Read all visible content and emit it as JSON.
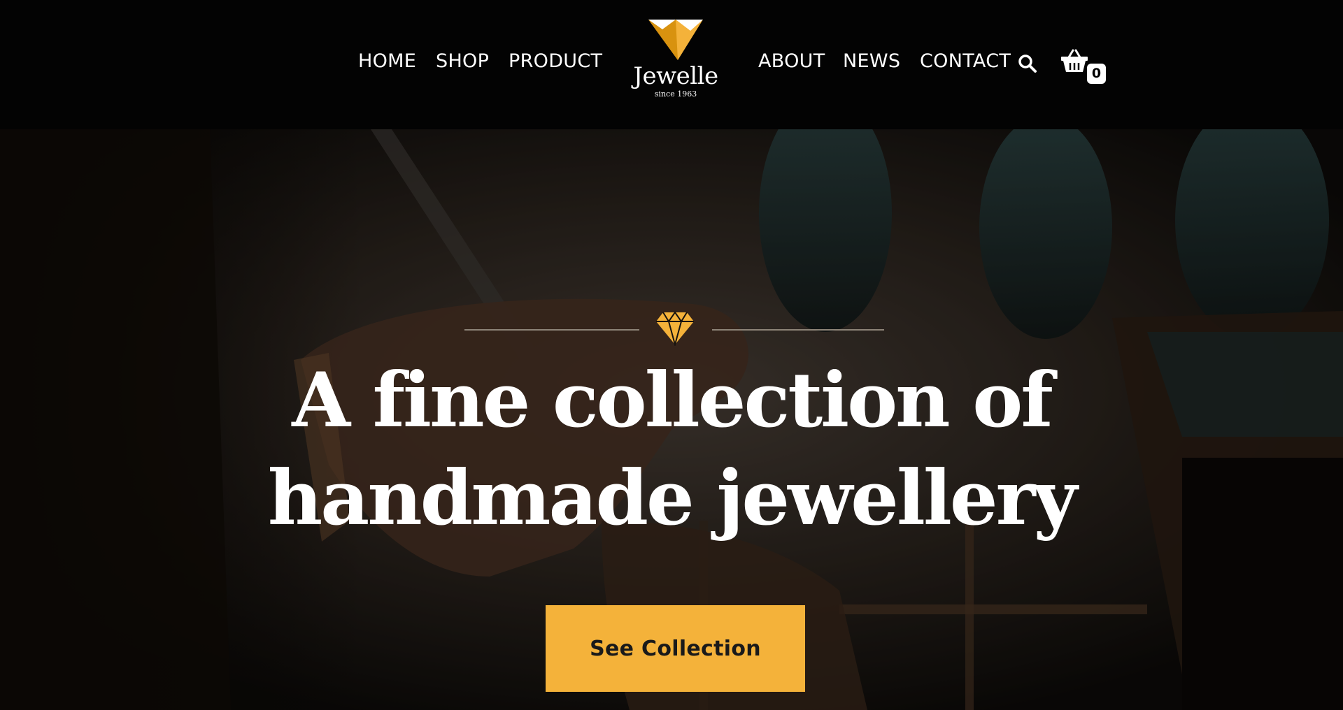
{
  "colors": {
    "accent": "#f4b23a",
    "header_bg": "#030303",
    "text": "#ffffff"
  },
  "nav": {
    "left": [
      {
        "label": "HOME"
      },
      {
        "label": "SHOP"
      },
      {
        "label": "PRODUCT"
      }
    ],
    "right": [
      {
        "label": "ABOUT"
      },
      {
        "label": "NEWS"
      },
      {
        "label": "CONTACT"
      }
    ]
  },
  "logo": {
    "name": "Jewelle",
    "tagline": "since 1963",
    "icon": "diamond-logo-icon"
  },
  "header_icons": {
    "search": "search-icon",
    "cart": "basket-icon",
    "cart_count": "0"
  },
  "hero": {
    "divider_icon": "diamond-icon",
    "title_line1": "A fine collection of",
    "title_line2": "handmade jewellery",
    "cta_label": "See Collection"
  }
}
